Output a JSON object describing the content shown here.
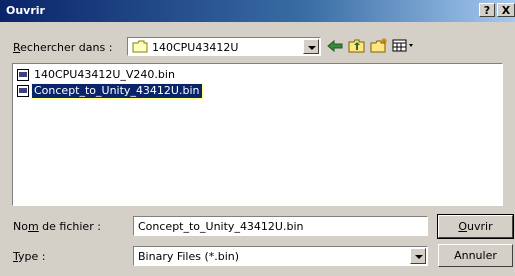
{
  "dialog": {
    "title": "Ouvrir",
    "help_btn": "?",
    "close_btn": "X"
  },
  "lookin": {
    "label_pre": "R",
    "label_rest": "echercher dans :",
    "folder": "140CPU43412U"
  },
  "files": [
    {
      "name": "140CPU43412U_V240.bin",
      "selected": false
    },
    {
      "name": "Concept_to_Unity_43412U.bin",
      "selected": true
    }
  ],
  "filename": {
    "label_pre": "No",
    "label_u": "m",
    "label_post": " de fichier :",
    "value": "Concept_to_Unity_43412U.bin"
  },
  "filetype": {
    "label_u": "T",
    "label_post": "ype :",
    "value": "Binary Files (*.bin)"
  },
  "buttons": {
    "open_u": "O",
    "open_rest": "uvrir",
    "cancel": "Annuler"
  },
  "icons": {
    "folder": "folder-icon",
    "back": "back-arrow-icon",
    "up": "up-folder-icon",
    "new_folder": "new-folder-icon",
    "view_menu": "view-menu-icon"
  }
}
